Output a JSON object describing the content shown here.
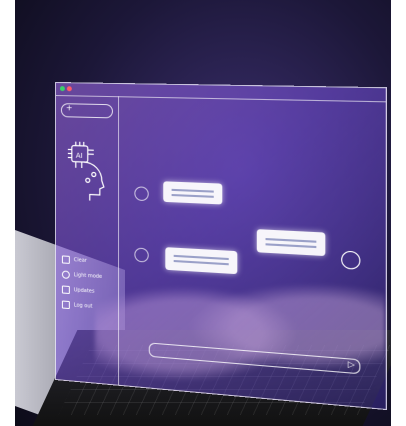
{
  "menu_items": [
    {
      "label": "Clear",
      "icon": "trash-icon"
    },
    {
      "label": "Light mode",
      "icon": "sun-icon"
    },
    {
      "label": "Updates",
      "icon": "edit-icon"
    },
    {
      "label": "Log out",
      "icon": "logout-icon"
    }
  ],
  "search": {
    "icon": "plus-icon"
  },
  "input": {
    "icon": "send-icon"
  },
  "colors": {
    "panel": "#8a5ae8",
    "text": "#ffffff",
    "dot_green": "#3ad06b",
    "dot_red": "#ff5a6a"
  }
}
